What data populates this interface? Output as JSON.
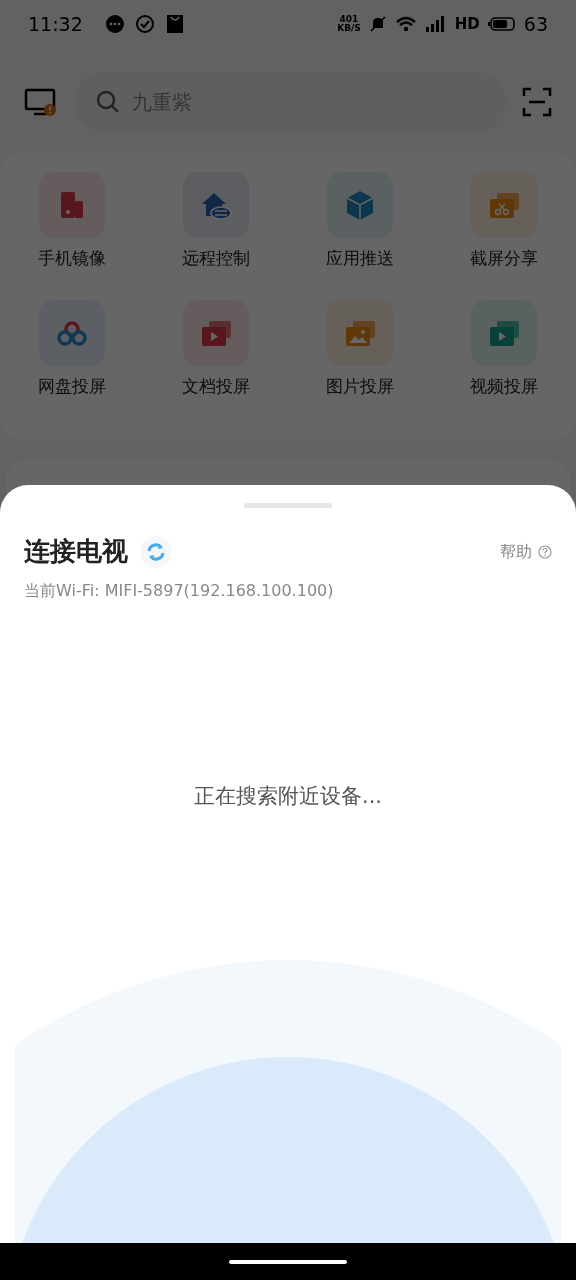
{
  "status_bar": {
    "time": "11:32",
    "net_speed": [
      "401",
      "KB/S"
    ],
    "network": "HD",
    "battery": "63"
  },
  "search": {
    "placeholder": "九重紫"
  },
  "features": [
    {
      "label": "手机镜像",
      "kind": "phone"
    },
    {
      "label": "远程控制",
      "kind": "remote"
    },
    {
      "label": "应用推送",
      "kind": "cube"
    },
    {
      "label": "截屏分享",
      "kind": "scissors"
    },
    {
      "label": "网盘投屏",
      "kind": "cloud"
    },
    {
      "label": "文档投屏",
      "kind": "document"
    },
    {
      "label": "图片投屏",
      "kind": "image"
    },
    {
      "label": "视频投屏",
      "kind": "video"
    }
  ],
  "sheet": {
    "title": "连接电视",
    "help": "帮助",
    "wifi": "当前Wi-Fi: MIFI-5897(192.168.100.100)",
    "status": "正在搜索附近设备..."
  }
}
